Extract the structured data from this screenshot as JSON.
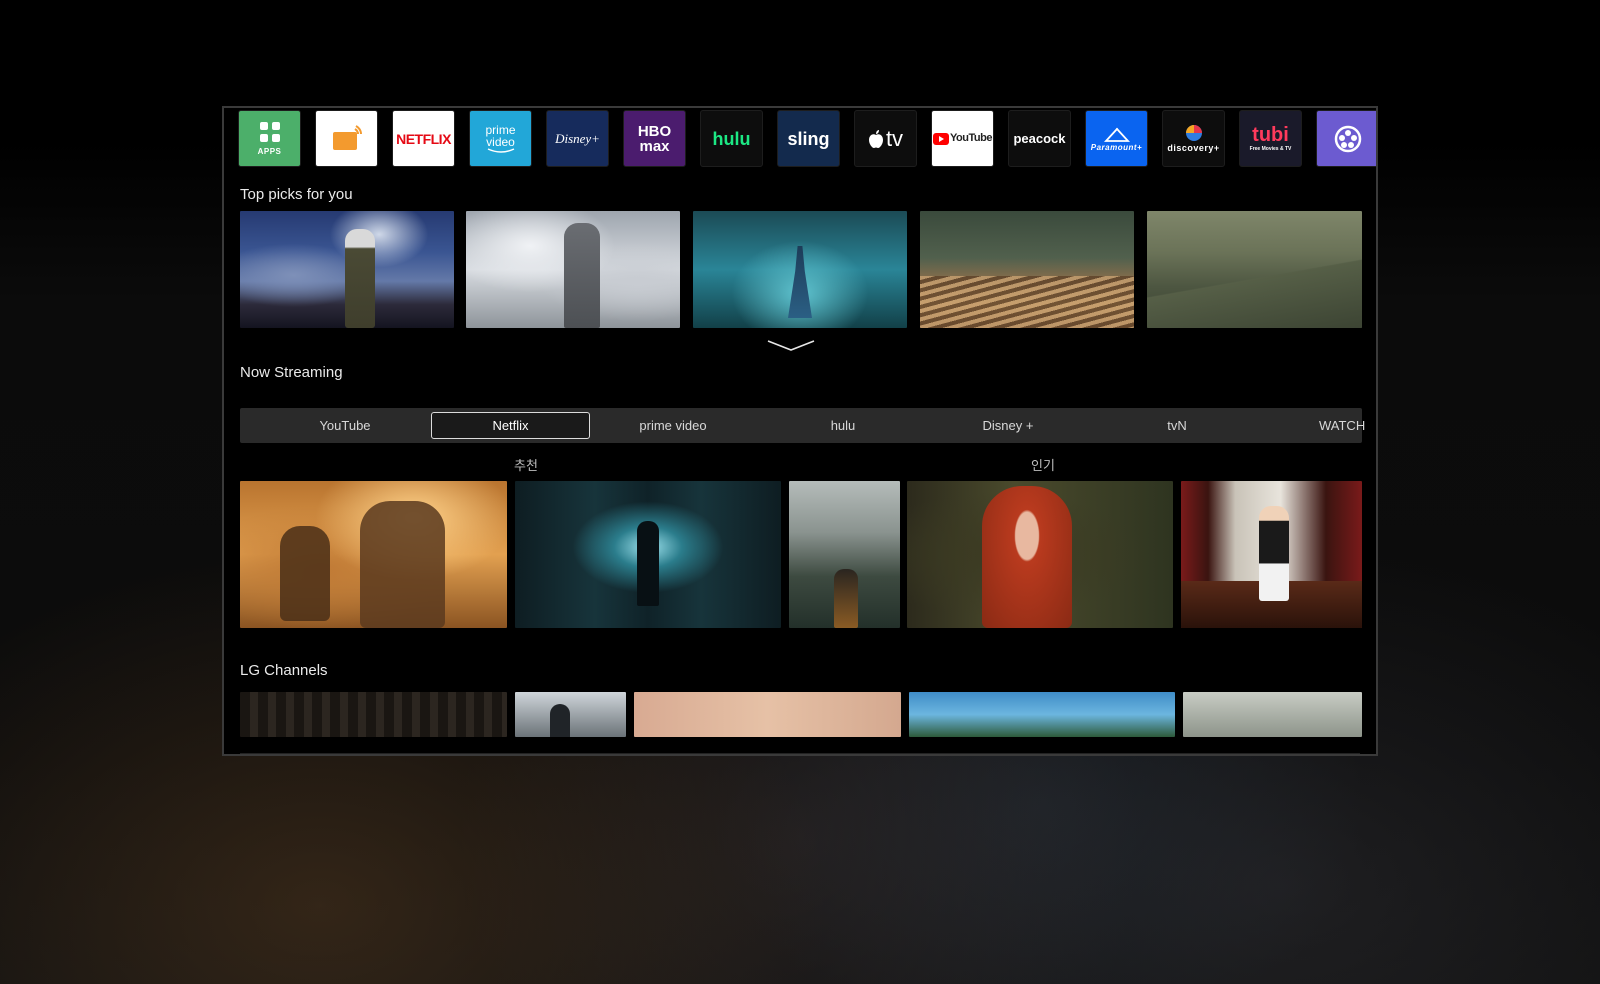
{
  "apps": [
    {
      "name": "apps-icon",
      "label": "",
      "sub": "APPS",
      "bg": "#4caf6a",
      "fg": "#ffffff"
    },
    {
      "name": "live-channels-icon",
      "label": "CH",
      "sub": "",
      "bg": "#ffffff",
      "fg": "#f08a24"
    },
    {
      "name": "netflix-app",
      "label": "NETFLIX",
      "sub": "",
      "bg": "#ffffff",
      "fg": "#e50914"
    },
    {
      "name": "prime-video-app",
      "label": "prime video",
      "sub": "",
      "bg": "#22a7d8",
      "fg": "#ffffff"
    },
    {
      "name": "disney-plus-app",
      "label": "Disney+",
      "sub": "",
      "bg": "#162b5c",
      "fg": "#ffffff"
    },
    {
      "name": "hbo-max-app",
      "label": "HBO max",
      "sub": "",
      "bg": "#4b1c6e",
      "fg": "#ffffff"
    },
    {
      "name": "hulu-app",
      "label": "hulu",
      "sub": "",
      "bg": "#0d0d0d",
      "fg": "#1ce783"
    },
    {
      "name": "sling-app",
      "label": "sling",
      "sub": "",
      "bg": "#132a4d",
      "fg": "#ffffff"
    },
    {
      "name": "apple-tv-app",
      "label": "tv",
      "sub": "",
      "bg": "#0d0d0d",
      "fg": "#ffffff"
    },
    {
      "name": "youtube-app",
      "label": "YouTube",
      "sub": "",
      "bg": "#ffffff",
      "fg": "#222222"
    },
    {
      "name": "peacock-app",
      "label": "peacock",
      "sub": "",
      "bg": "#0d0d0d",
      "fg": "#ffffff"
    },
    {
      "name": "paramount-plus-app",
      "label": "Paramount+",
      "sub": "",
      "bg": "#0a64f0",
      "fg": "#ffffff"
    },
    {
      "name": "discovery-plus-app",
      "label": "discovery+",
      "sub": "",
      "bg": "#0d0d0d",
      "fg": "#ffffff"
    },
    {
      "name": "tubi-app",
      "label": "tubi",
      "sub": "Free Movies & TV",
      "bg": "#1a1a2a",
      "fg": "#ff3a5c"
    },
    {
      "name": "lg-channels-app",
      "label": "",
      "sub": "",
      "bg": "#6c5bd0",
      "fg": "#ffffff"
    }
  ],
  "sections": {
    "top_picks": "Top picks for you",
    "now_streaming": "Now Streaming",
    "lg_channels": "LG Channels"
  },
  "tabs": [
    "YouTube",
    "Netflix",
    "prime video",
    "hulu",
    "Disney +",
    "tvN",
    "WATCH"
  ],
  "active_tab": "Netflix",
  "categories": {
    "left": "추천",
    "right": "인기"
  }
}
